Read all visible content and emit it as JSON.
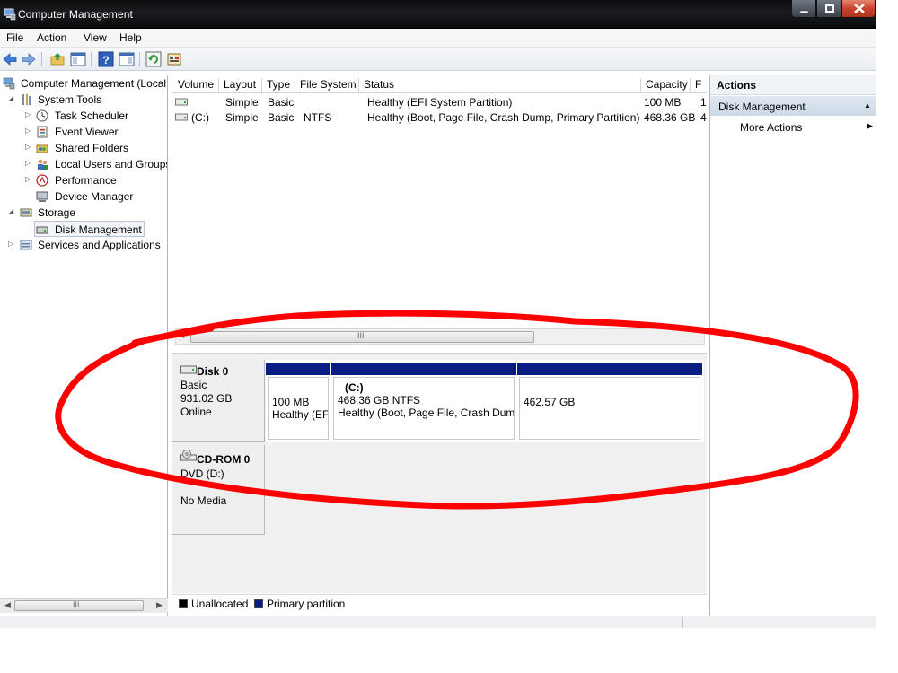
{
  "window": {
    "title": "Computer Management"
  },
  "menu": {
    "items": [
      "File",
      "Action",
      "View",
      "Help"
    ]
  },
  "tree": {
    "root": "Computer Management (Local",
    "system_tools": "System Tools",
    "task_scheduler": "Task Scheduler",
    "event_viewer": "Event Viewer",
    "shared_folders": "Shared Folders",
    "local_users": "Local Users and Groups",
    "performance": "Performance",
    "device_manager": "Device Manager",
    "storage": "Storage",
    "disk_management": "Disk Management",
    "services": "Services and Applications"
  },
  "scroll": {
    "grip": "III"
  },
  "volumes": {
    "columns": [
      "Volume",
      "Layout",
      "Type",
      "File System",
      "Status",
      "Capacity",
      "F"
    ],
    "rows": [
      {
        "volume": "",
        "layout": "Simple",
        "type": "Basic",
        "fs": "",
        "status": "Healthy (EFI System Partition)",
        "capacity": "100 MB",
        "free": "1"
      },
      {
        "volume": "(C:)",
        "layout": "Simple",
        "type": "Basic",
        "fs": "NTFS",
        "status": "Healthy (Boot, Page File, Crash Dump, Primary Partition)",
        "capacity": "468.36 GB",
        "free": "4"
      }
    ]
  },
  "disks": [
    {
      "name": "Disk 0",
      "kind": "Basic",
      "size": "931.02 GB",
      "state": "Online",
      "partitions": [
        {
          "title": "",
          "line1": "100 MB",
          "line2": "Healthy (EF"
        },
        {
          "title": "(C:)",
          "line1": "468.36 GB NTFS",
          "line2": "Healthy (Boot, Page File, Crash Dum"
        },
        {
          "title": "",
          "line1": "462.57 GB",
          "line2": ""
        }
      ]
    },
    {
      "name": "CD-ROM 0",
      "kind": "DVD (D:)",
      "state": "No Media"
    }
  ],
  "legend": {
    "unallocated": "Unallocated",
    "primary": "Primary partition"
  },
  "actions": {
    "title": "Actions",
    "section": "Disk Management",
    "more": "More Actions"
  },
  "colors": {
    "primary_partition": "#0a1b82",
    "unallocated": "#000000",
    "annotation": "#ff0000",
    "action_header": "#cdd9e7"
  }
}
